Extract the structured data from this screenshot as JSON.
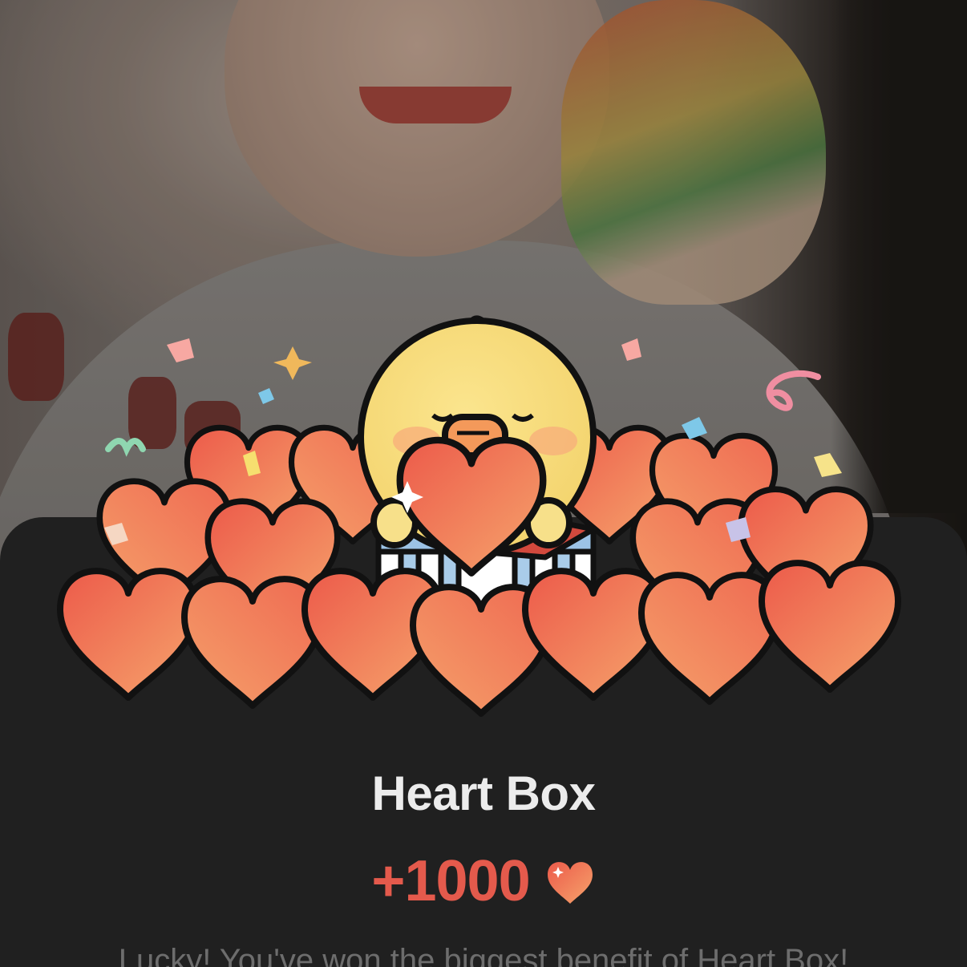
{
  "popup": {
    "title": "Heart Box",
    "reward_amount": "+1000",
    "reward_icon": "heart-icon",
    "message": "Lucky! You've won the biggest benefit of Heart Box!"
  },
  "colors": {
    "accent": "#e45a4c",
    "sheet_background": "#202020",
    "title_text": "#ececec",
    "message_text": "#6d6d6d",
    "heart_light": "#f4a26a",
    "heart_dark": "#ec5a4a",
    "chick": "#f6df7f"
  },
  "illustration": {
    "name": "heart-box-chick-illustration"
  }
}
